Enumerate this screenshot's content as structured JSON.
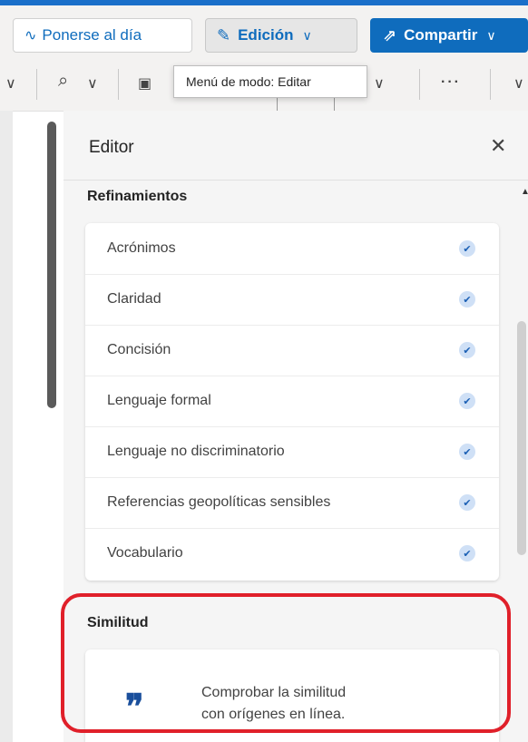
{
  "toolbar": {
    "update_label": "Ponerse al día",
    "edit_label": "Edición",
    "share_label": "Compartir"
  },
  "tooltip": {
    "text": "Menú de modo: Editar"
  },
  "editor": {
    "title": "Editor",
    "refinements_title": "Refinamientos",
    "refinements": [
      {
        "label": "Acrónimos"
      },
      {
        "label": "Claridad"
      },
      {
        "label": "Concisión"
      },
      {
        "label": "Lenguaje formal"
      },
      {
        "label": "Lenguaje no discriminatorio"
      },
      {
        "label": "Referencias geopolíticas sensibles"
      },
      {
        "label": "Vocabulario"
      }
    ],
    "similarity_title": "Similitud",
    "similarity_line1": "Comprobar la similitud",
    "similarity_line2": "con orígenes en línea."
  },
  "colors": {
    "accent": "#0f6cbd",
    "highlight": "#e0202a"
  }
}
